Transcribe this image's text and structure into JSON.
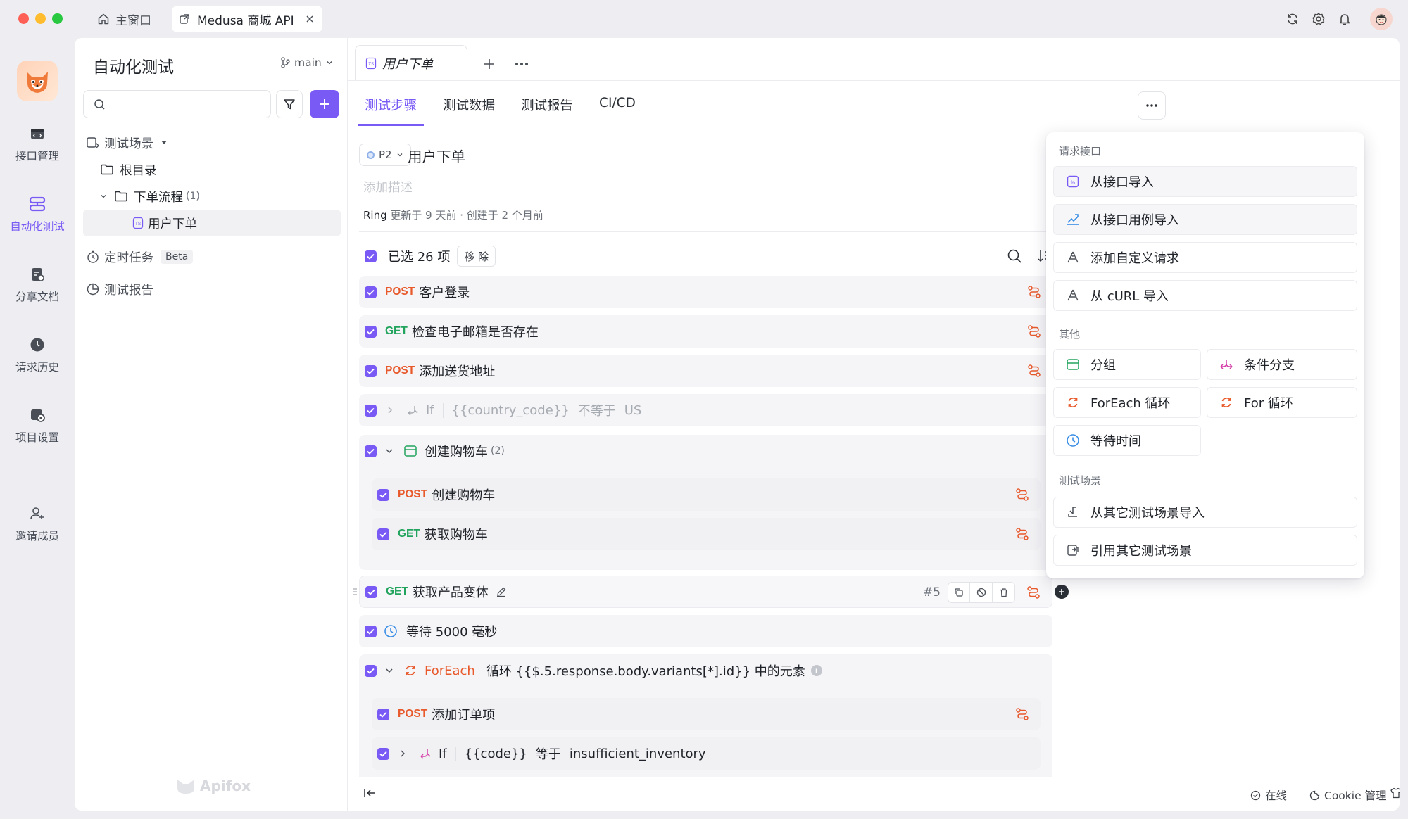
{
  "titlebar": {
    "home_tab": "主窗口",
    "project_tab": "Medusa 商城 API"
  },
  "rail": {
    "items": [
      {
        "label": "接口管理",
        "icon": "api-management-icon"
      },
      {
        "label": "自动化测试",
        "icon": "automation-icon"
      },
      {
        "label": "分享文档",
        "icon": "share-doc-icon"
      },
      {
        "label": "请求历史",
        "icon": "history-icon"
      },
      {
        "label": "项目设置",
        "icon": "project-settings-icon"
      },
      {
        "label": "邀请成员",
        "icon": "invite-member-icon"
      }
    ]
  },
  "sidebar": {
    "title": "自动化测试",
    "branch": "main",
    "search_placeholder": "",
    "tree": {
      "scenarios": "测试场景",
      "root": "根目录",
      "folder": "下单流程",
      "folder_count": "(1)",
      "case": "用户下单",
      "scheduled": "定时任务",
      "beta": "Beta",
      "reports": "测试报告"
    },
    "watermark": "Apifox"
  },
  "doc_tab": {
    "label": "用户下单"
  },
  "subtabs": [
    "测试步骤",
    "测试数据",
    "测试报告",
    "CI/CD"
  ],
  "case": {
    "priority": "P2",
    "title": "用户下单",
    "desc_placeholder": "添加描述",
    "meta_user": "Ring",
    "meta_text": " 更新于 9 天前 · 创建于 2 个月前"
  },
  "selection": {
    "text": "已选 26 项",
    "remove": "移 除"
  },
  "steps": {
    "s1": {
      "method": "POST",
      "name": "客户登录"
    },
    "s2": {
      "method": "GET",
      "name": "检查电子邮箱是否存在"
    },
    "s3": {
      "method": "POST",
      "name": "添加送货地址"
    },
    "s4": {
      "kw": "If",
      "var": "{{country_code}}",
      "op": "不等于",
      "val": "US"
    },
    "s5": {
      "name": "创建购物车",
      "count": "(2)"
    },
    "s5a": {
      "method": "POST",
      "name": "创建购物车"
    },
    "s5b": {
      "method": "GET",
      "name": "获取购物车"
    },
    "s6": {
      "method": "GET",
      "name": "获取产品变体",
      "index": "#5"
    },
    "s7": {
      "name": "等待 5000 毫秒"
    },
    "s8": {
      "kw": "ForEach",
      "text": "循环 {{$.5.response.body.variants[*].id}} 中的元素"
    },
    "s8a": {
      "method": "POST",
      "name": "添加订单项"
    },
    "s8b": {
      "kw": "If",
      "var": "{{code}}",
      "op": "等于",
      "val": "insufficient_inventory"
    }
  },
  "dropdown": {
    "section1": "请求接口",
    "i1": "从接口导入",
    "i2": "从接口用例导入",
    "i3": "添加自定义请求",
    "i4": "从 cURL 导入",
    "section2": "其他",
    "i5": "分组",
    "i6": "条件分支",
    "i7": "ForEach 循环",
    "i8": "For 循环",
    "i9": "等待时间",
    "section3": "测试场景",
    "i10": "从其它测试场景导入",
    "i11": "引用其它测试场景"
  },
  "statusbar": {
    "online": "在线",
    "cookie": "Cookie 管理"
  },
  "colors": {
    "accent": "#7a5af5",
    "post": "#e8592b",
    "get": "#23a45e"
  }
}
